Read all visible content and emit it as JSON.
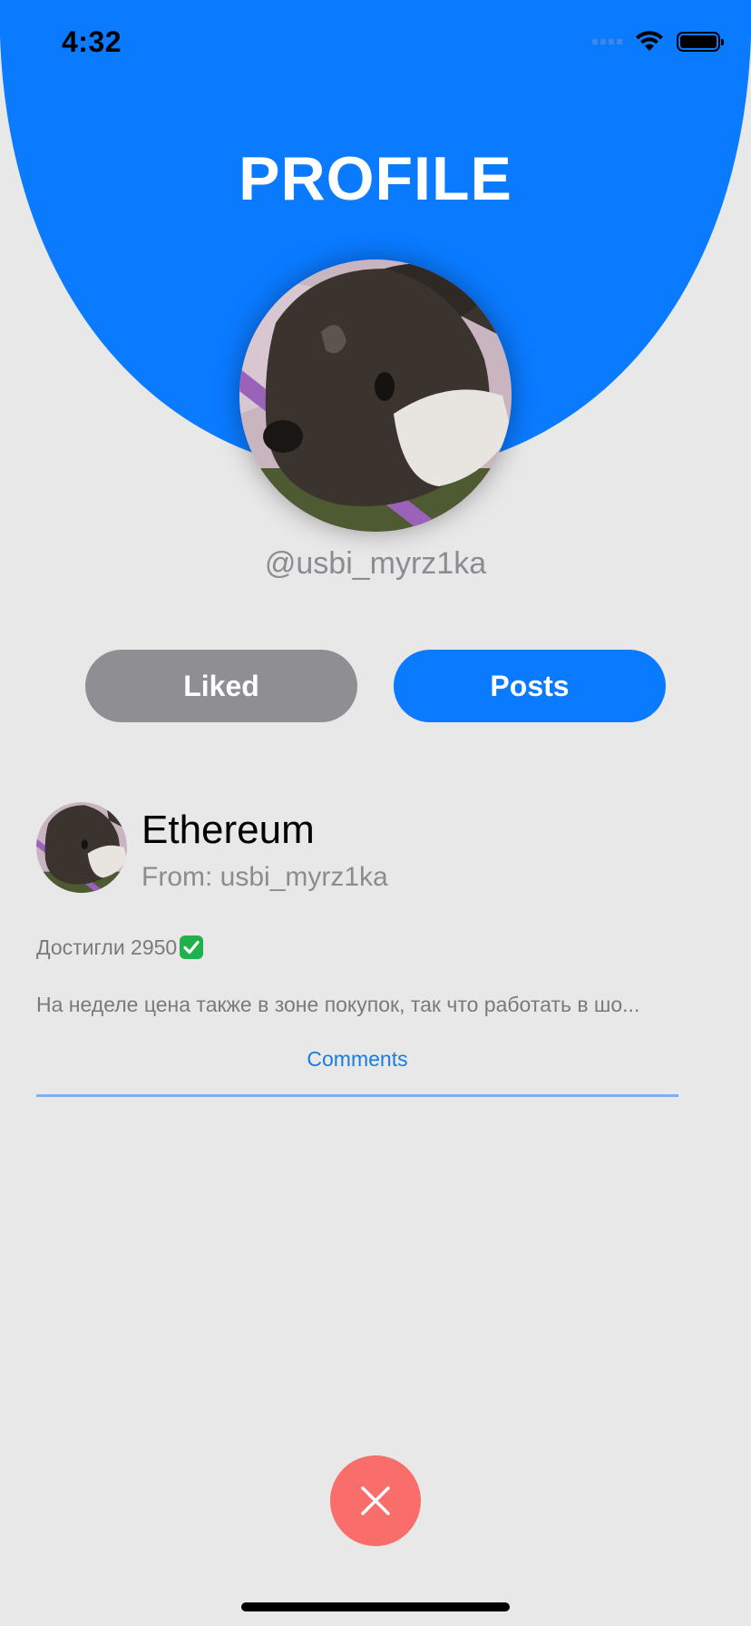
{
  "status_bar": {
    "time": "4:32"
  },
  "header": {
    "title": "PROFILE"
  },
  "profile": {
    "username": "@usbi_myrz1ka"
  },
  "tabs": {
    "liked_label": "Liked",
    "posts_label": "Posts"
  },
  "post": {
    "title": "Ethereum",
    "author": "From: usbi_myrz1ka",
    "headline": "Достигли 2950",
    "body": "На неделе цена также в зоне покупок, так что работать в шо...",
    "comments_label": "Comments"
  },
  "icons": {
    "close": "close-icon",
    "check": "check-mark-emoji",
    "wifi": "wifi-icon",
    "battery": "battery-icon",
    "signal": "signal-icon"
  },
  "colors": {
    "accent_blue": "#0a7aff",
    "liked_gray": "#8e8e93",
    "close_red": "#f96e6a",
    "background": "#e9e8e9",
    "link_blue": "#1a7be0"
  }
}
